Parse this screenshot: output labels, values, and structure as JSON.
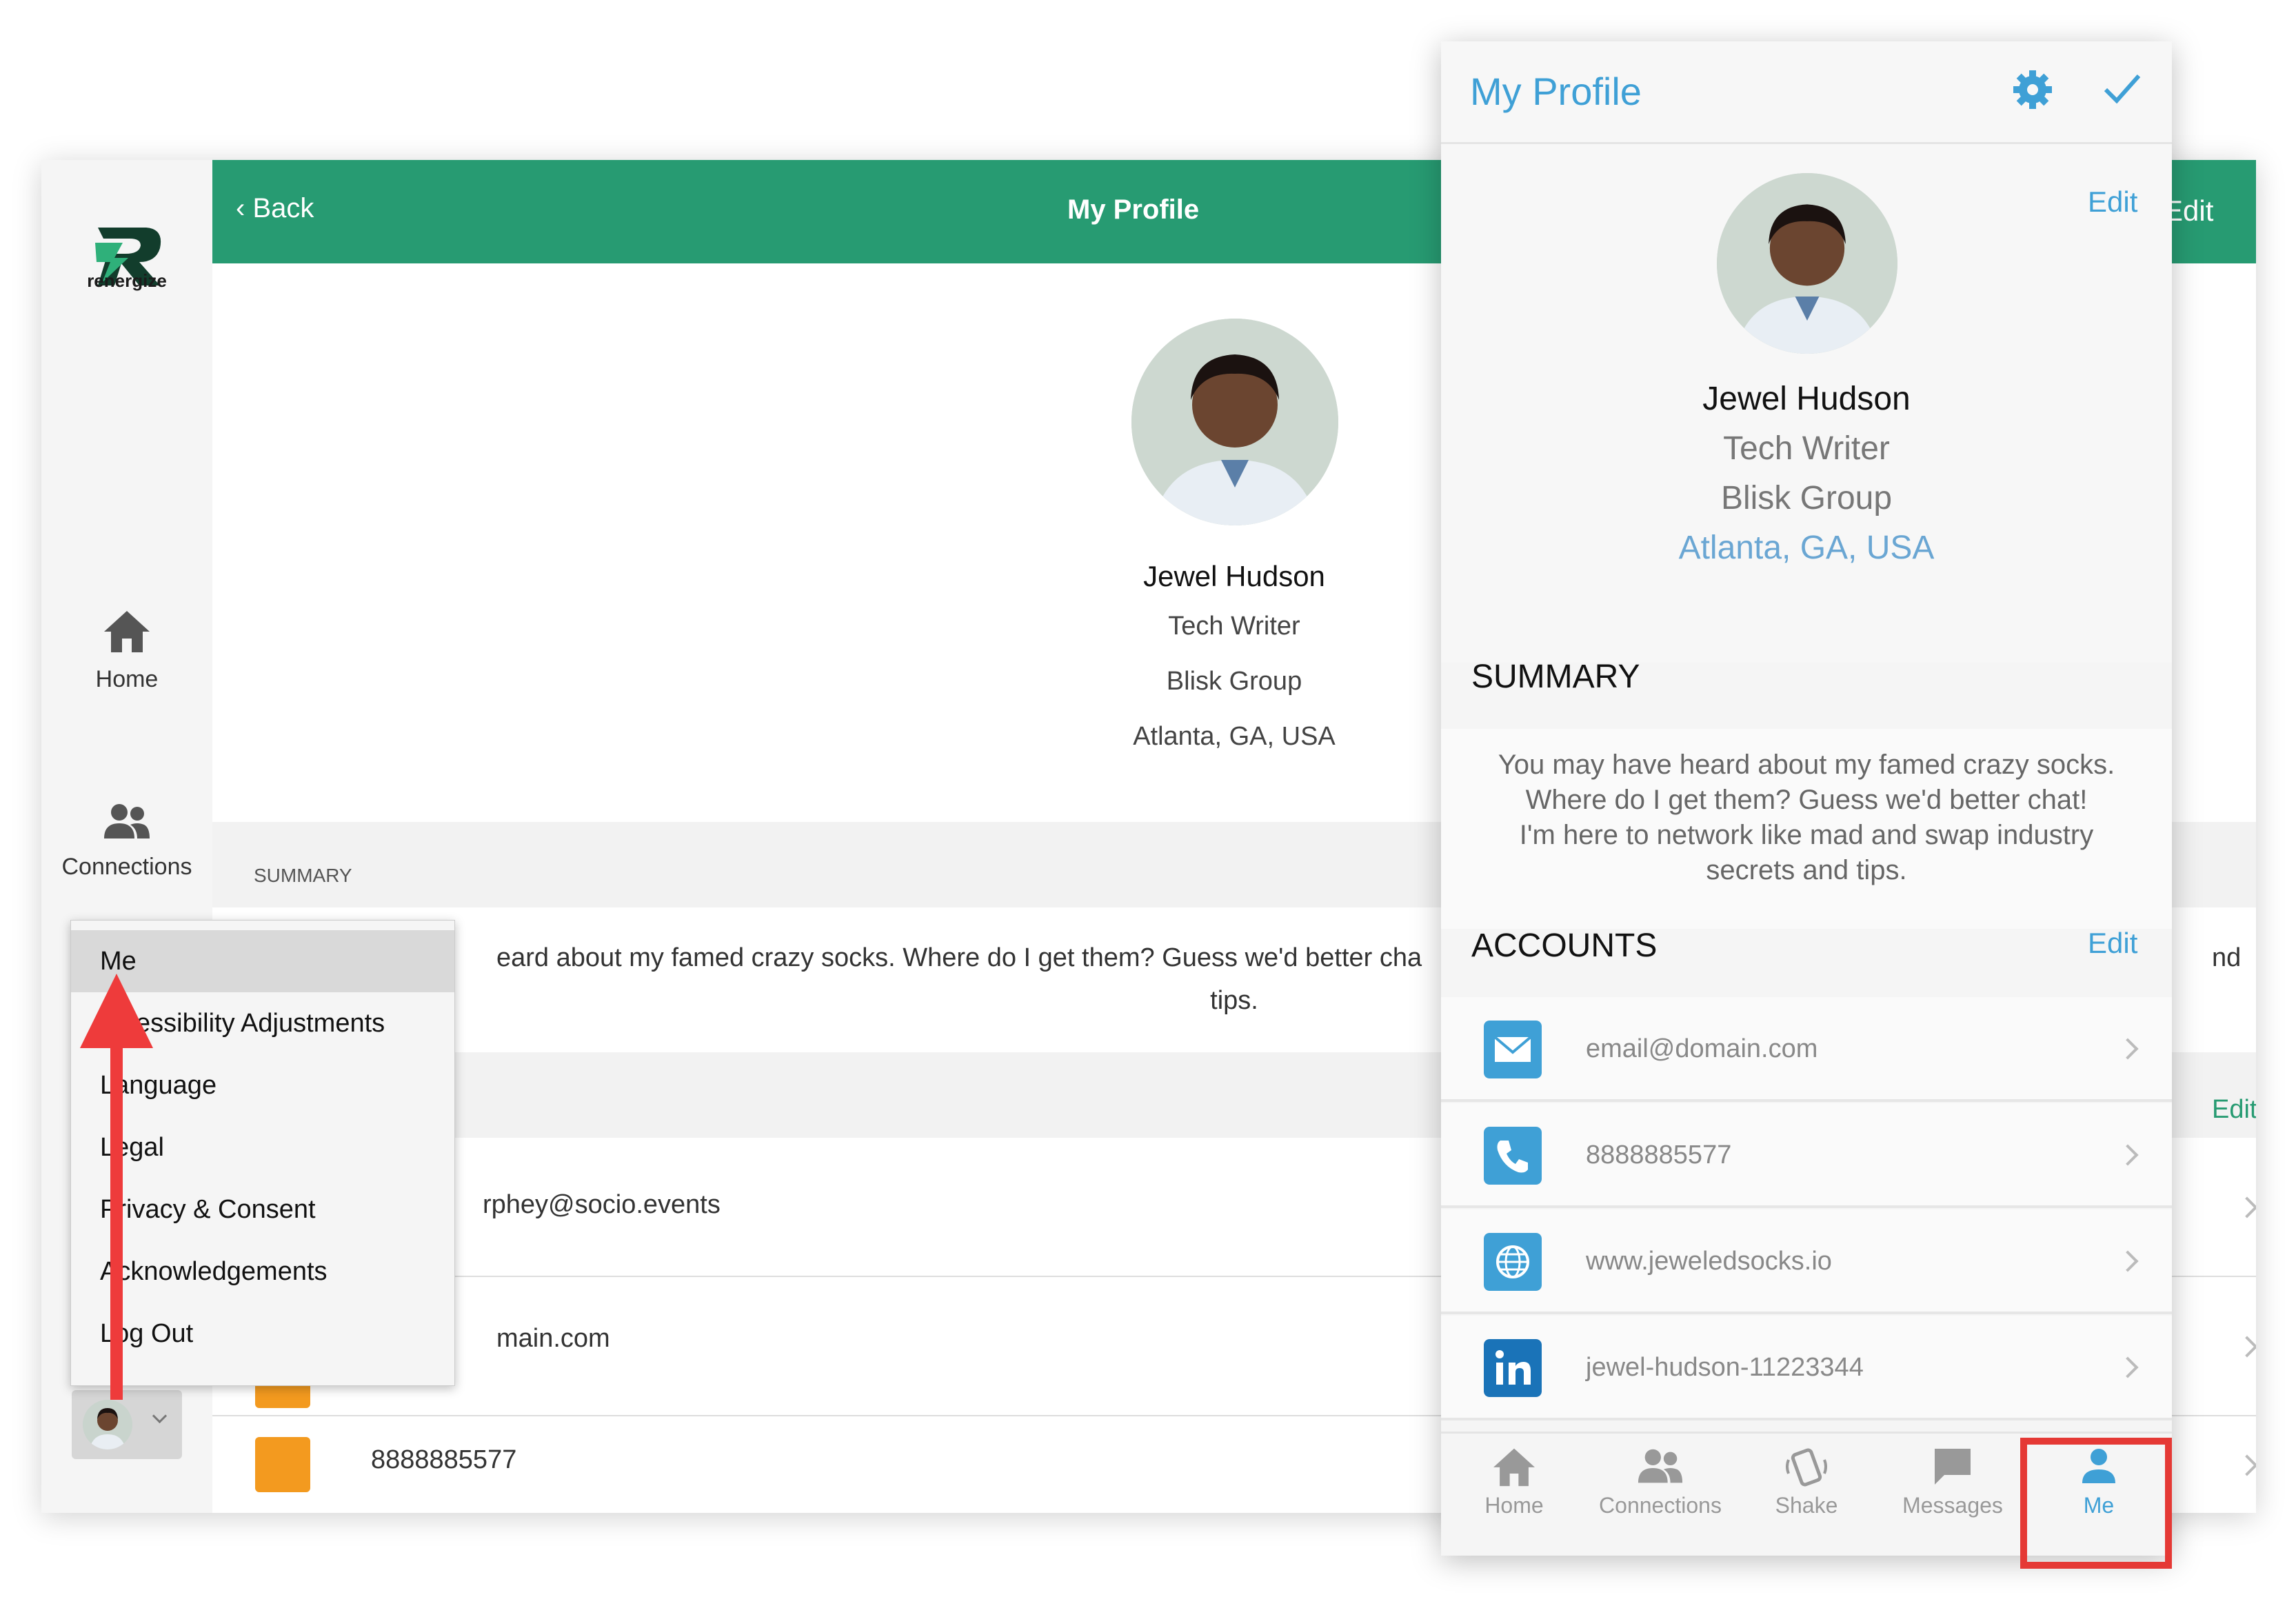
{
  "desktop": {
    "logo_text": "renergize",
    "nav": {
      "home_label": "Home",
      "connections_label": "Connections"
    },
    "topbar": {
      "back_label": "Back",
      "title": "My Profile",
      "edit_label": "Edit"
    },
    "profile": {
      "name": "Jewel Hudson",
      "title": "Tech Writer",
      "company": "Blisk Group",
      "location": "Atlanta, GA, USA"
    },
    "summary_label": "SUMMARY",
    "summary_partial": "eard about my famed crazy socks. Where do I get them? Guess we'd better cha",
    "summary_tail": "tips.",
    "summary_right_fragment": "nd",
    "accounts_edit_fragment": "Edit",
    "rows": [
      "rphey@socio.events",
      "main.com",
      "8888885577"
    ],
    "menu": {
      "items": [
        "Me",
        "essibility Adjustments",
        "anguage",
        "egal",
        "rivacy & Consent",
        "cknowledgements",
        "og Out"
      ],
      "item_prefixes": [
        "",
        "",
        "L",
        "L",
        "P",
        "A",
        "L"
      ]
    },
    "colors": {
      "brand_green": "#279b72",
      "arrow_red": "#ee3b3b",
      "row_icon_orange": "#f39a1f"
    }
  },
  "mobile": {
    "header": {
      "title": "My Profile"
    },
    "profile": {
      "edit_label": "Edit",
      "name": "Jewel Hudson",
      "title": "Tech Writer",
      "company": "Blisk Group",
      "location": "Atlanta, GA, USA"
    },
    "summary": {
      "label": "SUMMARY",
      "lines": [
        "You may have heard about my famed crazy socks.",
        "Where do I get them? Guess we'd better chat!",
        "I'm here to network like mad and swap industry",
        "secrets and tips."
      ]
    },
    "accounts": {
      "label": "ACCOUNTS",
      "edit_label": "Edit",
      "items": [
        {
          "icon": "email-icon",
          "value": "email@domain.com"
        },
        {
          "icon": "phone-icon",
          "value": "8888885577"
        },
        {
          "icon": "globe-icon",
          "value": "www.jeweledsocks.io"
        },
        {
          "icon": "linkedin-icon",
          "value": "jewel-hudson-11223344"
        }
      ]
    },
    "tabs": [
      {
        "icon": "home-icon",
        "label": "Home"
      },
      {
        "icon": "connections-icon",
        "label": "Connections"
      },
      {
        "icon": "shake-icon",
        "label": "Shake"
      },
      {
        "icon": "messages-icon",
        "label": "Messages"
      },
      {
        "icon": "person-icon",
        "label": "Me",
        "active": true
      }
    ],
    "colors": {
      "accent_blue": "#3fa0d6",
      "highlight_red": "#e53935",
      "linkedin_blue": "#1a73b8"
    }
  }
}
